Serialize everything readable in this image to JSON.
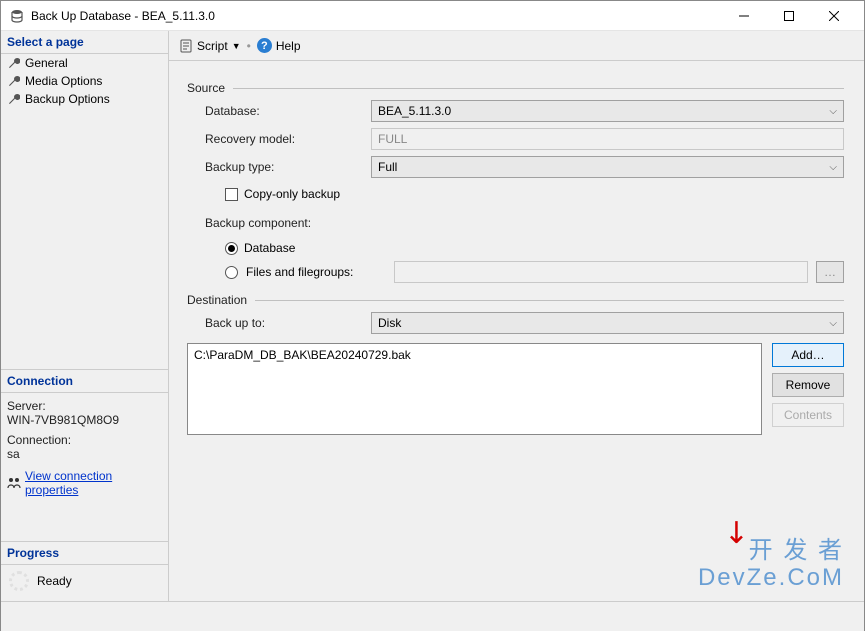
{
  "window": {
    "title": "Back Up Database - BEA_5.11.3.0"
  },
  "sidebar": {
    "select_page_header": "Select a page",
    "items": [
      {
        "label": "General"
      },
      {
        "label": "Media Options"
      },
      {
        "label": "Backup Options"
      }
    ],
    "connection_header": "Connection",
    "server_label": "Server:",
    "server_value": "WIN-7VB981QM8O9",
    "connection_label": "Connection:",
    "connection_value": "sa",
    "view_conn_link": "View connection properties",
    "progress_header": "Progress",
    "progress_status": "Ready"
  },
  "toolbar": {
    "script_label": "Script",
    "help_label": "Help"
  },
  "form": {
    "source_group": "Source",
    "database_label": "Database:",
    "database_value": "BEA_5.11.3.0",
    "recovery_label": "Recovery model:",
    "recovery_value": "FULL",
    "backup_type_label": "Backup type:",
    "backup_type_value": "Full",
    "copy_only_label": "Copy-only backup",
    "backup_component_label": "Backup component:",
    "radio_database": "Database",
    "radio_files": "Files and filegroups:",
    "destination_group": "Destination",
    "backup_to_label": "Back up to:",
    "backup_to_value": "Disk",
    "dest_item": "C:\\ParaDM_DB_BAK\\BEA20240729.bak",
    "add_btn": "Add…",
    "remove_btn": "Remove",
    "contents_btn": "Contents"
  },
  "watermark": "开 发 者\nDevZe.CoM"
}
